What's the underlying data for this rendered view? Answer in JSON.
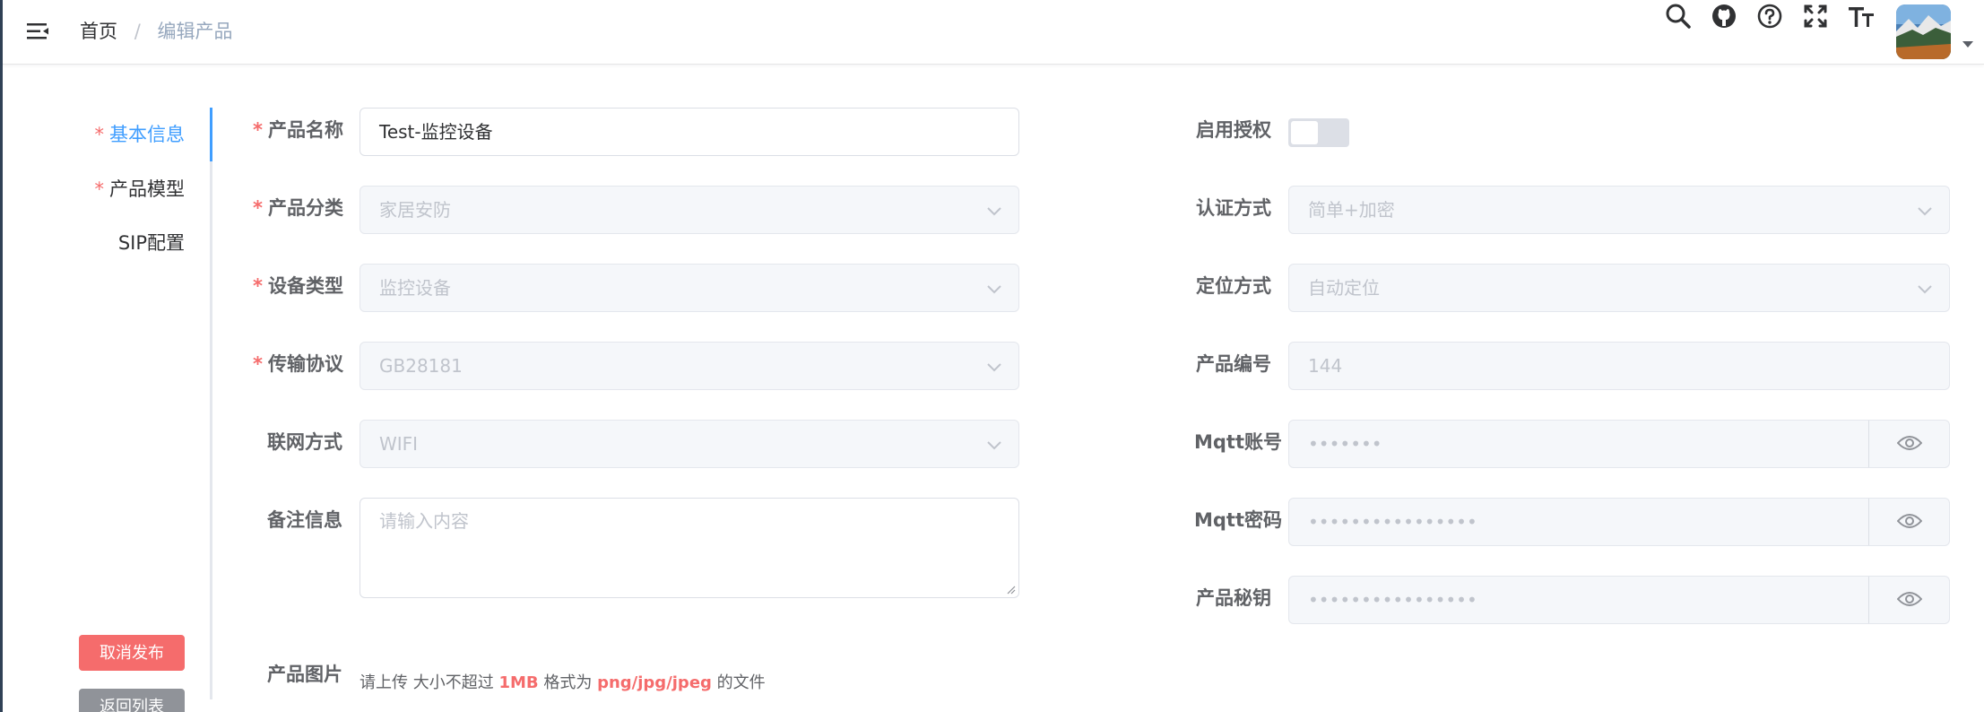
{
  "breadcrumb": {
    "home": "首页",
    "separator": "/",
    "current": "编辑产品"
  },
  "navbar": {
    "icons": [
      "search-icon",
      "github-icon",
      "help-icon",
      "fullscreen-icon",
      "font-size-icon"
    ]
  },
  "tabs": [
    {
      "label": "基本信息",
      "required": true,
      "active": true
    },
    {
      "label": "产品模型",
      "required": true,
      "active": false
    },
    {
      "label": "SIP配置",
      "required": false,
      "active": false
    }
  ],
  "actions": {
    "unpublish": "取消发布",
    "back": "返回列表"
  },
  "form_left": {
    "name": {
      "label": "产品名称",
      "value": "Test-监控设备"
    },
    "category": {
      "label": "产品分类",
      "value": "家居安防"
    },
    "device_type": {
      "label": "设备类型",
      "value": "监控设备"
    },
    "protocol": {
      "label": "传输协议",
      "value": "GB28181"
    },
    "network": {
      "label": "联网方式",
      "value": "WIFI"
    },
    "remark": {
      "label": "备注信息",
      "placeholder": "请输入内容"
    }
  },
  "form_right": {
    "auth_enable": {
      "label": "启用授权",
      "on": false
    },
    "auth_method": {
      "label": "认证方式",
      "value": "简单+加密"
    },
    "location": {
      "label": "定位方式",
      "value": "自动定位"
    },
    "product_id": {
      "label": "产品编号",
      "value": "144"
    },
    "mqtt_account": {
      "label": "Mqtt账号",
      "value": "•••••••"
    },
    "mqtt_password": {
      "label": "Mqtt密码",
      "value": "••••••••••••••••"
    },
    "product_secret": {
      "label": "产品秘钥",
      "value": "••••••••••••••••"
    }
  },
  "image": {
    "label": "产品图片",
    "hint_prefix": "请上传 大小不超过",
    "size": "1MB",
    "hint_mid": "格式为",
    "formats": "png/jpg/jpeg",
    "hint_suffix": "的文件"
  },
  "colors": {
    "primary": "#409eff",
    "danger": "#f56c6c",
    "info": "#909399"
  }
}
